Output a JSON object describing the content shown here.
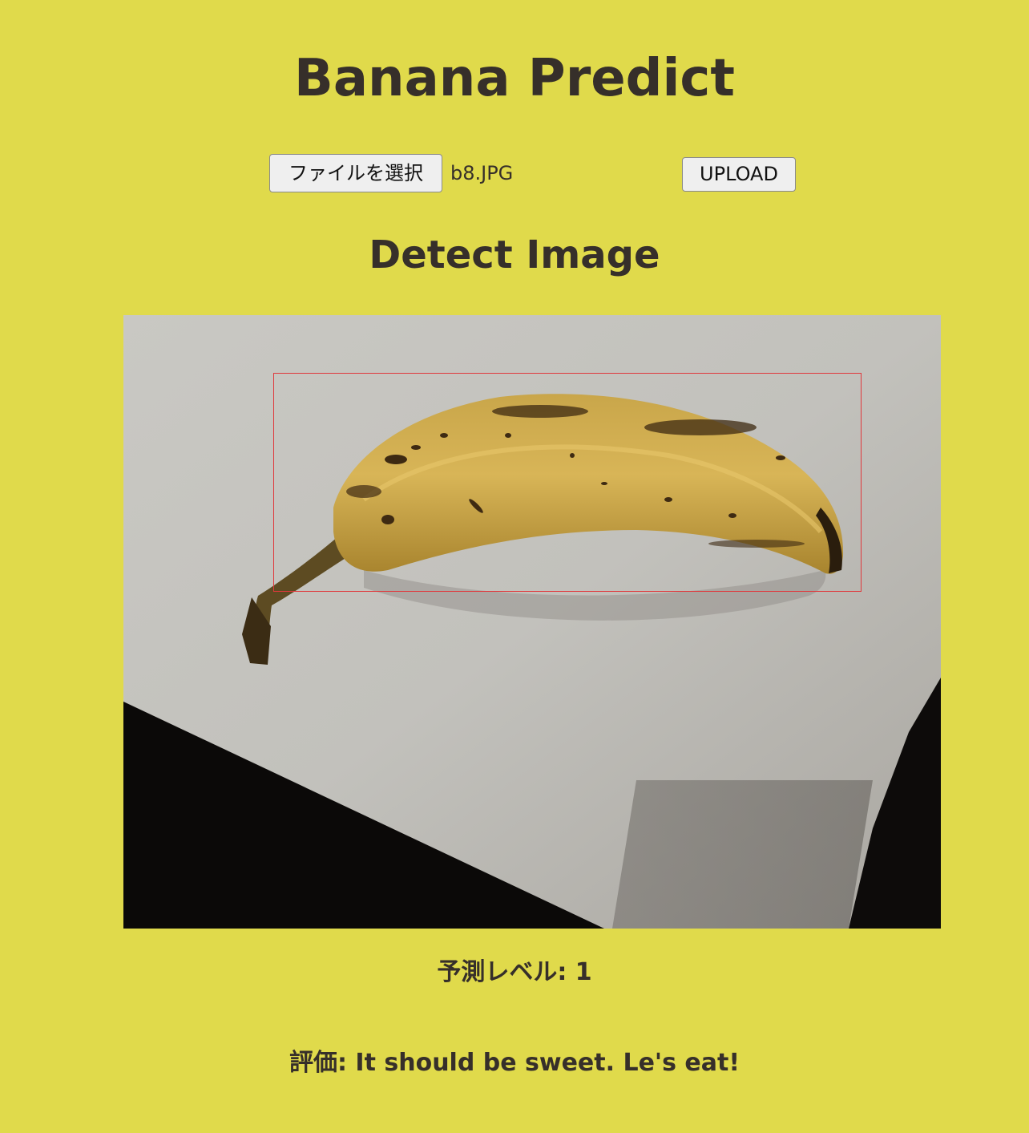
{
  "header": {
    "title": "Banana Predict"
  },
  "upload_form": {
    "file_button_label": "ファイルを選択",
    "selected_file": "b8.JPG",
    "upload_button_label": "UPLOAD"
  },
  "detection": {
    "heading": "Detect Image",
    "bounding_box_color": "#e0383c"
  },
  "result": {
    "level_label": "予測レベル:",
    "level_value": "1",
    "evaluation_label": "評価:",
    "evaluation_text": "It should be sweet. Le's eat!"
  },
  "colors": {
    "background": "#e0da4b",
    "text": "#362f2a"
  }
}
